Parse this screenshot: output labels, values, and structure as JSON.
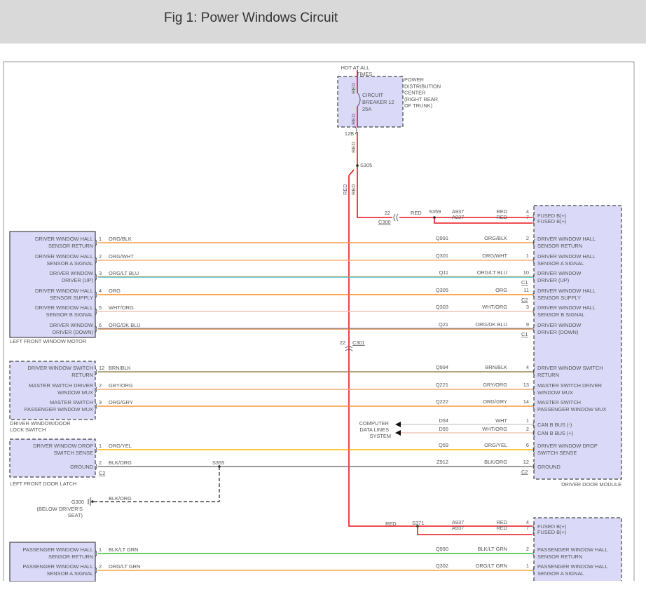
{
  "header": {
    "title": "Fig 1: Power Windows Circuit"
  },
  "pdc": {
    "hot_label": [
      "HOT AT ALL",
      "TIMES"
    ],
    "name_lines": [
      "POWER",
      "DISTRIBUTION",
      "CENTER",
      "(RIGHT REAR",
      "OF TRUNK)"
    ],
    "breaker_lines": [
      "CIRCUIT",
      "BREAKER 12",
      "25A"
    ],
    "wire_color": "RED",
    "pin": "12B"
  },
  "splices": {
    "s305": "S305",
    "s359": "S359",
    "s355": "S355",
    "s371": "S371"
  },
  "connectors": {
    "c300": {
      "name": "C300",
      "pin": "22",
      "wire_color": "RED"
    },
    "c301": {
      "name": "C301",
      "pin": "22"
    }
  },
  "feed_wire": {
    "color_label": "RED",
    "circuit": "A937"
  },
  "driver_module": {
    "name": "DRIVER DOOR MODULE",
    "fused_pins": [
      {
        "pin": "4",
        "label": "FUSED B(+)"
      },
      {
        "pin": "7",
        "label": "FUSED B(+)"
      }
    ]
  },
  "passenger_module": {
    "fused_pins": [
      {
        "pin": "4",
        "label": "FUSED B(+)"
      },
      {
        "pin": "7",
        "label": "FUSED B(+)"
      }
    ]
  },
  "left_components": [
    {
      "name": [
        "LEFT FRONT WINDOW MOTOR"
      ],
      "dashed": false
    },
    {
      "name": [
        "DRIVER WINDOW/DOOR",
        "LOCK SWITCH"
      ],
      "dashed": true
    },
    {
      "name": [
        "LEFT FRONT DOOR LATCH"
      ],
      "dashed": true
    },
    {
      "name": [],
      "dashed": false
    }
  ],
  "rows": [
    {
      "group": 0,
      "lpin": "1",
      "lcolor": "ORG/BLK",
      "circuit": "Q991",
      "color": "ORG/BLK",
      "rpin": "2",
      "rconn": "",
      "lconn": "",
      "left": [
        "DRIVER WINDOW HALL",
        "SENSOR RETURN"
      ],
      "right": [
        "DRIVER WINDOW HALL",
        "SENSOR RETURN"
      ],
      "hex": "#f7a04a"
    },
    {
      "group": 0,
      "lpin": "2",
      "lcolor": "ORG/WHT",
      "circuit": "Q301",
      "color": "ORG/WHT",
      "rpin": "1",
      "rconn": "",
      "lconn": "",
      "left": [
        "DRIVER WINDOW HALL",
        "SENSOR A SIGNAL"
      ],
      "right": [
        "DRIVER WINDOW HALL",
        "SENSOR A SIGNAL"
      ],
      "hex": "#f9b27a"
    },
    {
      "group": 0,
      "lpin": "3",
      "lcolor": "ORG/LT BLU",
      "circuit": "Q11",
      "color": "ORG/LT BLU",
      "rpin": "10",
      "rconn": "C1",
      "lconn": "",
      "left": [
        "DRIVER WINDOW",
        "DRIVER (UP)"
      ],
      "right": [
        "DRIVER WINDOW",
        "DRIVER (UP)"
      ],
      "hex": "#3cc2c8"
    },
    {
      "group": 0,
      "lpin": "4",
      "lcolor": "ORG",
      "circuit": "Q305",
      "color": "ORG",
      "rpin": "11",
      "rconn": "C2",
      "lconn": "",
      "left": [
        "DRIVER WINDOW HALL",
        "SENSOR SUPPLY"
      ],
      "right": [
        "DRIVER WINDOW HALL",
        "SENSOR SUPPLY"
      ],
      "hex": "#ff8a1c"
    },
    {
      "group": 0,
      "lpin": "5",
      "lcolor": "WHT/ORG",
      "circuit": "Q303",
      "color": "WHT/ORG",
      "rpin": "3",
      "rconn": "",
      "lconn": "",
      "left": [
        "DRIVER WINDOW HALL",
        "SENSOR B SIGNAL"
      ],
      "right": [
        "DRIVER WINDOW HALL",
        "SENSOR B SIGNAL"
      ],
      "hex": "#f2c4b4"
    },
    {
      "group": 0,
      "lpin": "6",
      "lcolor": "ORG/DK BLU",
      "circuit": "Q21",
      "color": "ORG/DK BLU",
      "rpin": "9",
      "rconn": "C1",
      "lconn": "",
      "left": [
        "DRIVER WINDOW",
        "DRIVER (DOWN)"
      ],
      "right": [
        "DRIVER WINDOW",
        "DRIVER (DOWN)"
      ],
      "hex": "#e08a3c"
    },
    {
      "group": 1,
      "lpin": "12",
      "lcolor": "BRN/BLK",
      "circuit": "Q994",
      "color": "BRN/BLK",
      "rpin": "4",
      "rconn": "",
      "lconn": "",
      "left": [
        "DRIVER WINDOW SWITCH",
        "RETURN"
      ],
      "right": [
        "DRIVER WINDOW SWITCH",
        "RETURN"
      ],
      "hex": "#9a8852"
    },
    {
      "group": 1,
      "lpin": "2",
      "lcolor": "GRY/ORG",
      "circuit": "Q221",
      "color": "GRY/ORG",
      "rpin": "13",
      "rconn": "",
      "lconn": "",
      "left": [
        "MASTER SWITCH DRIVER",
        "WINDOW MUX"
      ],
      "right": [
        "MASTER SWITCH DRIVER",
        "WINDOW MUX"
      ],
      "hex": "#f4ab72"
    },
    {
      "group": 1,
      "lpin": "3",
      "lcolor": "ORG/GRY",
      "circuit": "Q222",
      "color": "ORG/GRY",
      "rpin": "14",
      "rconn": "",
      "lconn": "",
      "left": [
        "MASTER SWITCH",
        "PASSENGER WINDOW MUX"
      ],
      "right": [
        "MASTER SWITCH",
        "PASSENGER WINDOW MUX"
      ],
      "hex": "#fa9540"
    },
    {
      "group": 2,
      "lpin": "1",
      "lcolor": "ORG/YEL",
      "circuit": "Q59",
      "color": "ORG/YEL",
      "rpin": "6",
      "rconn": "",
      "lconn": "",
      "left": [
        "DRIVER WINDOW DROP",
        "SWITCH SENSE"
      ],
      "right": [
        "DRIVER WINDOW DROP",
        "SWITCH SENSE"
      ],
      "hex": "#ffb000"
    },
    {
      "group": 2,
      "lpin": "2",
      "lcolor": "BLK/ORG",
      "circuit": "Z912",
      "color": "BLK/ORG",
      "rpin": "12",
      "rconn": "C2",
      "lconn": "C2",
      "left": [
        "GROUND"
      ],
      "right": [
        "GROUND"
      ],
      "hex": "#7a7a7a"
    },
    {
      "group": 3,
      "lpin": "1",
      "lcolor": "BLK/LT GRN",
      "circuit": "Q990",
      "color": "BLK/LT GRN",
      "rpin": "2",
      "rconn": "",
      "lconn": "",
      "left": [
        "PASSENGER WINDOW HALL",
        "SENSOR RETURN"
      ],
      "right": [
        "PASSENGER WINDOW HALL",
        "SENSOR RETURN"
      ],
      "hex": "#34c034"
    },
    {
      "group": 3,
      "lpin": "2",
      "lcolor": "ORG/LT GRN",
      "circuit": "Q302",
      "color": "ORG/LT GRN",
      "rpin": "1",
      "rconn": "",
      "lconn": "",
      "left": [
        "PASSENGER WINDOW HALL",
        "SENSOR A SIGNAL"
      ],
      "right": [
        "PASSENGER WINDOW HALL",
        "SENSOR A SIGNAL"
      ],
      "hex": "#f2a83a"
    }
  ],
  "can_rows": [
    {
      "circuit": "D54",
      "color": "WHT",
      "rpin": "1",
      "right": "CAN B BUS (-)",
      "hex": "#d2d2d2"
    },
    {
      "circuit": "D55",
      "color": "WHT/ORG",
      "rpin": "2",
      "right": "CAN B BUS (+)",
      "hex": "#f0c8b8"
    }
  ],
  "can_destination": [
    "COMPUTER",
    "DATA LINES",
    "SYSTEM"
  ],
  "ground": {
    "name": "G300",
    "location": [
      "(BELOW DRIVER'S",
      "SEAT)"
    ],
    "color": "BLK/ORG"
  },
  "colors": {
    "red_wire": "#e8141c",
    "module_fill": "#dadaf8",
    "border": "#444444"
  }
}
